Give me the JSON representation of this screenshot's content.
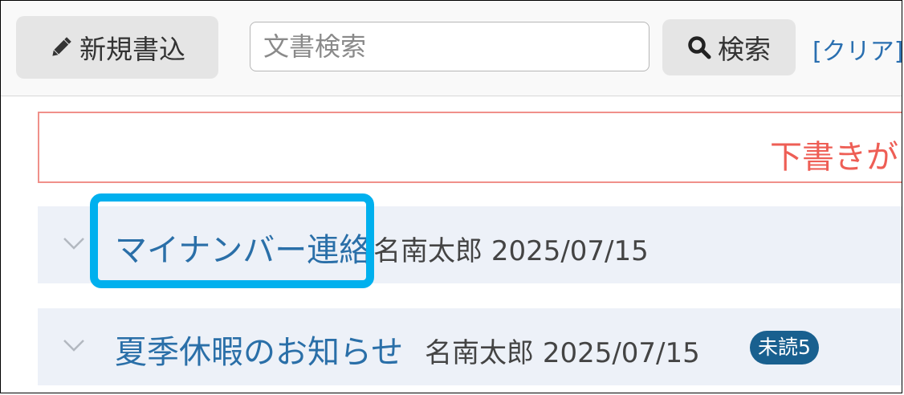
{
  "toolbar": {
    "new_post_label": "新規書込",
    "new_post_icon": "pencil-icon",
    "search_placeholder": "文書検索",
    "search_value": "",
    "search_button_label": "検索",
    "search_button_icon": "magnifier-icon",
    "clear_link_label": "[クリア]"
  },
  "draft_banner": {
    "text": "下書きが"
  },
  "threads": [
    {
      "title": "マイナンバー連絡",
      "author": "名南太郎",
      "date": "2025/07/15"
    },
    {
      "title": "夏季休暇のお知らせ",
      "author": "名南太郎",
      "date": "2025/07/15",
      "unread_badge": "未読5"
    }
  ],
  "annotation": {
    "highlight_color": "#00b0ee",
    "highlighted_item": "マイナンバー連絡"
  },
  "colors": {
    "link": "#2a6fa8",
    "draft_border": "#f0908a",
    "draft_text": "#ee5e55",
    "row_background": "#edf1f8",
    "badge_background": "#19608f"
  }
}
